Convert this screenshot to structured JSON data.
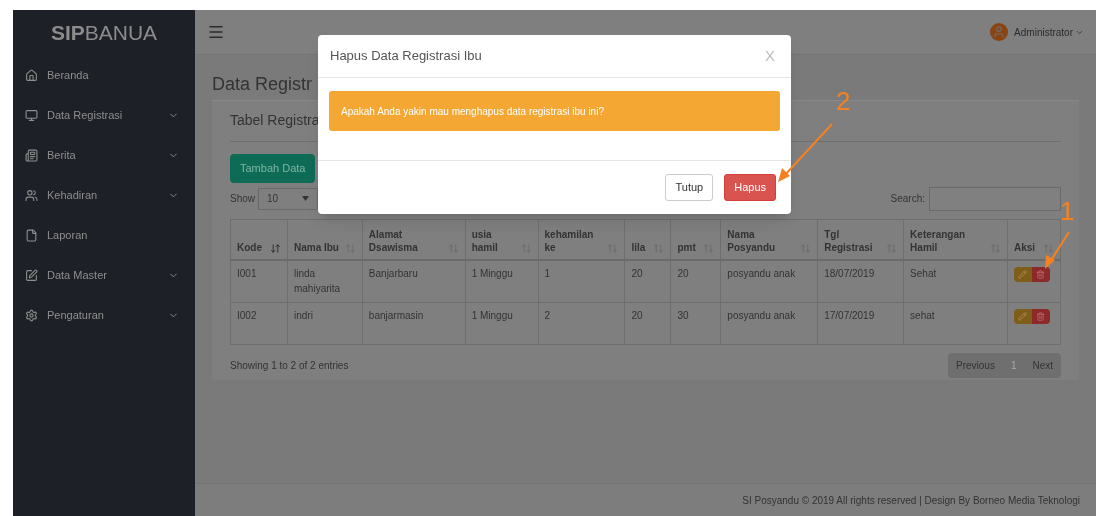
{
  "brand": {
    "bold": "SIP",
    "regular": "BANUA"
  },
  "header": {
    "user": "Administrator"
  },
  "sidebar": {
    "items": [
      {
        "label": "Beranda",
        "expandable": false
      },
      {
        "label": "Data Registrasi",
        "expandable": true
      },
      {
        "label": "Berita",
        "expandable": true
      },
      {
        "label": "Kehadiran",
        "expandable": true
      },
      {
        "label": "Laporan",
        "expandable": false
      },
      {
        "label": "Data Master",
        "expandable": true
      },
      {
        "label": "Pengaturan",
        "expandable": true
      }
    ]
  },
  "page_title": "Data Registr",
  "box": {
    "title": "Tabel Registra",
    "add_button": "Tambah Data",
    "show_label": "Show",
    "page_size": "10",
    "search_label": "Search:",
    "columns": [
      {
        "label": "Kode",
        "sorted": true
      },
      {
        "label": "Nama Ibu",
        "sorted": false
      },
      {
        "label": "Alamat Dsawisma",
        "sorted": false
      },
      {
        "label": "usia hamil",
        "sorted": false
      },
      {
        "label": "kehamilan ke",
        "sorted": false
      },
      {
        "label": "lila",
        "sorted": false
      },
      {
        "label": "pmt",
        "sorted": false
      },
      {
        "label": "Nama Posyandu",
        "sorted": false
      },
      {
        "label": "Tgl Registrasi",
        "sorted": false
      },
      {
        "label": "Keterangan Hamil",
        "sorted": false
      },
      {
        "label": "Aksi",
        "sorted": false
      }
    ],
    "rows": [
      [
        "I001",
        "linda mahiyarita",
        "Banjarbaru",
        "1 Minggu",
        "1",
        "20",
        "20",
        "posyandu anak",
        "18/07/2019",
        "Sehat"
      ],
      [
        "I002",
        "indri",
        "banjarmasin",
        "1 Minggu",
        "2",
        "20",
        "30",
        "posyandu anak",
        "17/07/2019",
        "sehat"
      ]
    ],
    "info": "Showing 1 to 2 of 2 entries",
    "pagination": [
      {
        "label": "Previous",
        "selected": false
      },
      {
        "label": "1",
        "selected": true
      },
      {
        "label": "Next",
        "selected": false
      }
    ]
  },
  "footer": "SI Posyandu © 2019 All rights reserved | Design By Borneo Media Teknologi",
  "modal": {
    "title": "Hapus Data Registrasi Ibu",
    "close": "X",
    "message": "Apakah Anda yakin mau menghapus data registrasi ibu ini?",
    "buttons": [
      {
        "label": "Tutup",
        "kind": "default"
      },
      {
        "label": "Hapus",
        "kind": "danger"
      }
    ]
  },
  "annotations": [
    {
      "label": "2"
    },
    {
      "label": "1"
    }
  ]
}
